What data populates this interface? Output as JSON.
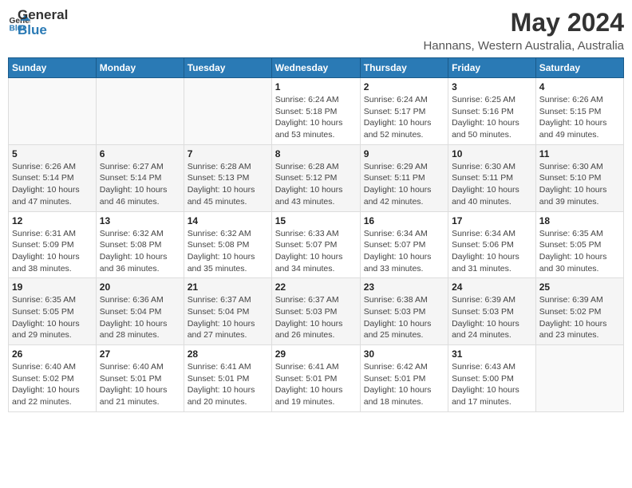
{
  "header": {
    "logo_general": "General",
    "logo_blue": "Blue",
    "title": "May 2024",
    "subtitle": "Hannans, Western Australia, Australia"
  },
  "weekdays": [
    "Sunday",
    "Monday",
    "Tuesday",
    "Wednesday",
    "Thursday",
    "Friday",
    "Saturday"
  ],
  "weeks": [
    [
      {
        "day": "",
        "sunrise": "",
        "sunset": "",
        "daylight": ""
      },
      {
        "day": "",
        "sunrise": "",
        "sunset": "",
        "daylight": ""
      },
      {
        "day": "",
        "sunrise": "",
        "sunset": "",
        "daylight": ""
      },
      {
        "day": "1",
        "sunrise": "Sunrise: 6:24 AM",
        "sunset": "Sunset: 5:18 PM",
        "daylight": "Daylight: 10 hours and 53 minutes."
      },
      {
        "day": "2",
        "sunrise": "Sunrise: 6:24 AM",
        "sunset": "Sunset: 5:17 PM",
        "daylight": "Daylight: 10 hours and 52 minutes."
      },
      {
        "day": "3",
        "sunrise": "Sunrise: 6:25 AM",
        "sunset": "Sunset: 5:16 PM",
        "daylight": "Daylight: 10 hours and 50 minutes."
      },
      {
        "day": "4",
        "sunrise": "Sunrise: 6:26 AM",
        "sunset": "Sunset: 5:15 PM",
        "daylight": "Daylight: 10 hours and 49 minutes."
      }
    ],
    [
      {
        "day": "5",
        "sunrise": "Sunrise: 6:26 AM",
        "sunset": "Sunset: 5:14 PM",
        "daylight": "Daylight: 10 hours and 47 minutes."
      },
      {
        "day": "6",
        "sunrise": "Sunrise: 6:27 AM",
        "sunset": "Sunset: 5:14 PM",
        "daylight": "Daylight: 10 hours and 46 minutes."
      },
      {
        "day": "7",
        "sunrise": "Sunrise: 6:28 AM",
        "sunset": "Sunset: 5:13 PM",
        "daylight": "Daylight: 10 hours and 45 minutes."
      },
      {
        "day": "8",
        "sunrise": "Sunrise: 6:28 AM",
        "sunset": "Sunset: 5:12 PM",
        "daylight": "Daylight: 10 hours and 43 minutes."
      },
      {
        "day": "9",
        "sunrise": "Sunrise: 6:29 AM",
        "sunset": "Sunset: 5:11 PM",
        "daylight": "Daylight: 10 hours and 42 minutes."
      },
      {
        "day": "10",
        "sunrise": "Sunrise: 6:30 AM",
        "sunset": "Sunset: 5:11 PM",
        "daylight": "Daylight: 10 hours and 40 minutes."
      },
      {
        "day": "11",
        "sunrise": "Sunrise: 6:30 AM",
        "sunset": "Sunset: 5:10 PM",
        "daylight": "Daylight: 10 hours and 39 minutes."
      }
    ],
    [
      {
        "day": "12",
        "sunrise": "Sunrise: 6:31 AM",
        "sunset": "Sunset: 5:09 PM",
        "daylight": "Daylight: 10 hours and 38 minutes."
      },
      {
        "day": "13",
        "sunrise": "Sunrise: 6:32 AM",
        "sunset": "Sunset: 5:08 PM",
        "daylight": "Daylight: 10 hours and 36 minutes."
      },
      {
        "day": "14",
        "sunrise": "Sunrise: 6:32 AM",
        "sunset": "Sunset: 5:08 PM",
        "daylight": "Daylight: 10 hours and 35 minutes."
      },
      {
        "day": "15",
        "sunrise": "Sunrise: 6:33 AM",
        "sunset": "Sunset: 5:07 PM",
        "daylight": "Daylight: 10 hours and 34 minutes."
      },
      {
        "day": "16",
        "sunrise": "Sunrise: 6:34 AM",
        "sunset": "Sunset: 5:07 PM",
        "daylight": "Daylight: 10 hours and 33 minutes."
      },
      {
        "day": "17",
        "sunrise": "Sunrise: 6:34 AM",
        "sunset": "Sunset: 5:06 PM",
        "daylight": "Daylight: 10 hours and 31 minutes."
      },
      {
        "day": "18",
        "sunrise": "Sunrise: 6:35 AM",
        "sunset": "Sunset: 5:05 PM",
        "daylight": "Daylight: 10 hours and 30 minutes."
      }
    ],
    [
      {
        "day": "19",
        "sunrise": "Sunrise: 6:35 AM",
        "sunset": "Sunset: 5:05 PM",
        "daylight": "Daylight: 10 hours and 29 minutes."
      },
      {
        "day": "20",
        "sunrise": "Sunrise: 6:36 AM",
        "sunset": "Sunset: 5:04 PM",
        "daylight": "Daylight: 10 hours and 28 minutes."
      },
      {
        "day": "21",
        "sunrise": "Sunrise: 6:37 AM",
        "sunset": "Sunset: 5:04 PM",
        "daylight": "Daylight: 10 hours and 27 minutes."
      },
      {
        "day": "22",
        "sunrise": "Sunrise: 6:37 AM",
        "sunset": "Sunset: 5:03 PM",
        "daylight": "Daylight: 10 hours and 26 minutes."
      },
      {
        "day": "23",
        "sunrise": "Sunrise: 6:38 AM",
        "sunset": "Sunset: 5:03 PM",
        "daylight": "Daylight: 10 hours and 25 minutes."
      },
      {
        "day": "24",
        "sunrise": "Sunrise: 6:39 AM",
        "sunset": "Sunset: 5:03 PM",
        "daylight": "Daylight: 10 hours and 24 minutes."
      },
      {
        "day": "25",
        "sunrise": "Sunrise: 6:39 AM",
        "sunset": "Sunset: 5:02 PM",
        "daylight": "Daylight: 10 hours and 23 minutes."
      }
    ],
    [
      {
        "day": "26",
        "sunrise": "Sunrise: 6:40 AM",
        "sunset": "Sunset: 5:02 PM",
        "daylight": "Daylight: 10 hours and 22 minutes."
      },
      {
        "day": "27",
        "sunrise": "Sunrise: 6:40 AM",
        "sunset": "Sunset: 5:01 PM",
        "daylight": "Daylight: 10 hours and 21 minutes."
      },
      {
        "day": "28",
        "sunrise": "Sunrise: 6:41 AM",
        "sunset": "Sunset: 5:01 PM",
        "daylight": "Daylight: 10 hours and 20 minutes."
      },
      {
        "day": "29",
        "sunrise": "Sunrise: 6:41 AM",
        "sunset": "Sunset: 5:01 PM",
        "daylight": "Daylight: 10 hours and 19 minutes."
      },
      {
        "day": "30",
        "sunrise": "Sunrise: 6:42 AM",
        "sunset": "Sunset: 5:01 PM",
        "daylight": "Daylight: 10 hours and 18 minutes."
      },
      {
        "day": "31",
        "sunrise": "Sunrise: 6:43 AM",
        "sunset": "Sunset: 5:00 PM",
        "daylight": "Daylight: 10 hours and 17 minutes."
      },
      {
        "day": "",
        "sunrise": "",
        "sunset": "",
        "daylight": ""
      }
    ]
  ]
}
